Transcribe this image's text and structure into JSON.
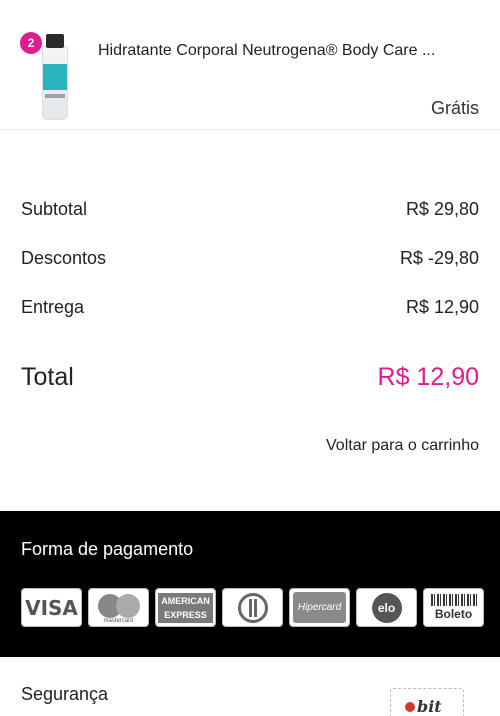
{
  "cart_item": {
    "quantity": "2",
    "name": "Hidratante Corporal Neutrogena® Body Care ...",
    "price": "Grátis"
  },
  "summary": {
    "subtotal_label": "Subtotal",
    "subtotal_value": "R$ 29,80",
    "discount_label": "Descontos",
    "discount_value": "R$ -29,80",
    "delivery_label": "Entrega",
    "delivery_value": "R$ 12,90",
    "total_label": "Total",
    "total_value": "R$ 12,90"
  },
  "back_link": "Voltar para o carrinho",
  "payment": {
    "title": "Forma de pagamento",
    "cards": {
      "visa": "VISA",
      "mastercard": "mastercard",
      "amex_line1": "AMERICAN",
      "amex_line2": "EXPRESS",
      "hipercard": "Hipercard",
      "elo": "elo",
      "boleto": "Boleto"
    }
  },
  "security": {
    "title": "Segurança",
    "badge_text": "bit"
  },
  "colors": {
    "accent": "#dd1c8f",
    "payment_bg": "#000000"
  }
}
